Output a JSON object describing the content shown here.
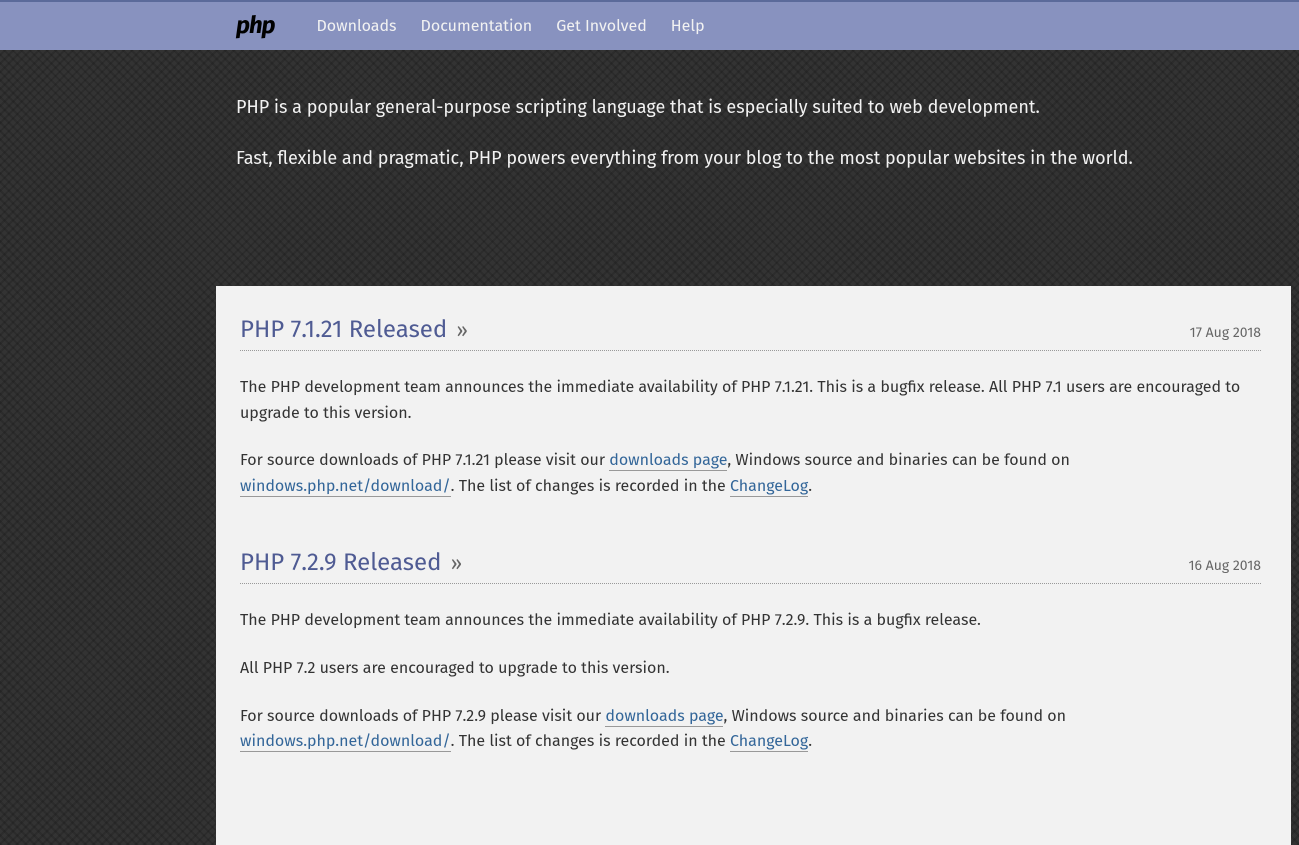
{
  "nav": {
    "logo": "php",
    "items": [
      {
        "label": "Downloads"
      },
      {
        "label": "Documentation"
      },
      {
        "label": "Get Involved"
      },
      {
        "label": "Help"
      }
    ]
  },
  "hero": {
    "p1": "PHP is a popular general-purpose scripting language that is especially suited to web development.",
    "p2": "Fast, flexible and pragmatic, PHP powers everything from your blog to the most popular websites in the world."
  },
  "articles": [
    {
      "title": "PHP 7.1.21 Released",
      "date": "17 Aug 2018",
      "paragraphs": [
        {
          "parts": [
            {
              "t": "text",
              "v": "The PHP development team announces the immediate availability of PHP 7.1.21. This is a bugfix release. All PHP 7.1 users are encouraged to upgrade to this version."
            }
          ]
        },
        {
          "parts": [
            {
              "t": "text",
              "v": "For source downloads of PHP 7.1.21 please visit our "
            },
            {
              "t": "link",
              "v": "downloads page"
            },
            {
              "t": "text",
              "v": ", Windows source and binaries can be found on "
            },
            {
              "t": "link",
              "v": "windows.php.net/download/"
            },
            {
              "t": "text",
              "v": ". The list of changes is recorded in the "
            },
            {
              "t": "link",
              "v": "ChangeLog"
            },
            {
              "t": "text",
              "v": "."
            }
          ]
        }
      ]
    },
    {
      "title": "PHP 7.2.9 Released",
      "date": "16 Aug 2018",
      "paragraphs": [
        {
          "parts": [
            {
              "t": "text",
              "v": "The PHP development team announces the immediate availability of PHP 7.2.9. This is a bugfix release."
            }
          ]
        },
        {
          "parts": [
            {
              "t": "text",
              "v": "All PHP 7.2 users are encouraged to upgrade to this version."
            }
          ]
        },
        {
          "parts": [
            {
              "t": "text",
              "v": "For source downloads of PHP 7.2.9 please visit our "
            },
            {
              "t": "link",
              "v": "downloads page"
            },
            {
              "t": "text",
              "v": ", Windows source and binaries can be found on "
            },
            {
              "t": "link",
              "v": "windows.php.net/download/"
            },
            {
              "t": "text",
              "v": ". The list of changes is recorded in the "
            },
            {
              "t": "link",
              "v": "ChangeLog"
            },
            {
              "t": "text",
              "v": "."
            }
          ]
        }
      ]
    }
  ]
}
